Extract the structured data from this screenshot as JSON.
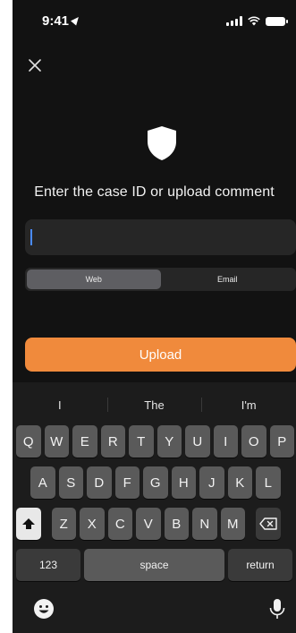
{
  "status_bar": {
    "time": "9:41"
  },
  "title": "Enter the case ID or upload comment",
  "input": {
    "value": ""
  },
  "segments": [
    {
      "label": "Web",
      "active": true
    },
    {
      "label": "Email",
      "active": false
    }
  ],
  "upload_button": {
    "label": "Upload",
    "color": "#f08a3c"
  },
  "keyboard": {
    "suggestions": [
      "I",
      "The",
      "I'm"
    ],
    "row1": [
      "Q",
      "W",
      "E",
      "R",
      "T",
      "Y",
      "U",
      "I",
      "O",
      "P"
    ],
    "row2": [
      "A",
      "S",
      "D",
      "F",
      "G",
      "H",
      "J",
      "K",
      "L"
    ],
    "row3": [
      "Z",
      "X",
      "C",
      "V",
      "B",
      "N",
      "M"
    ],
    "numbers_label": "123",
    "space_label": "space",
    "return_label": "return"
  }
}
